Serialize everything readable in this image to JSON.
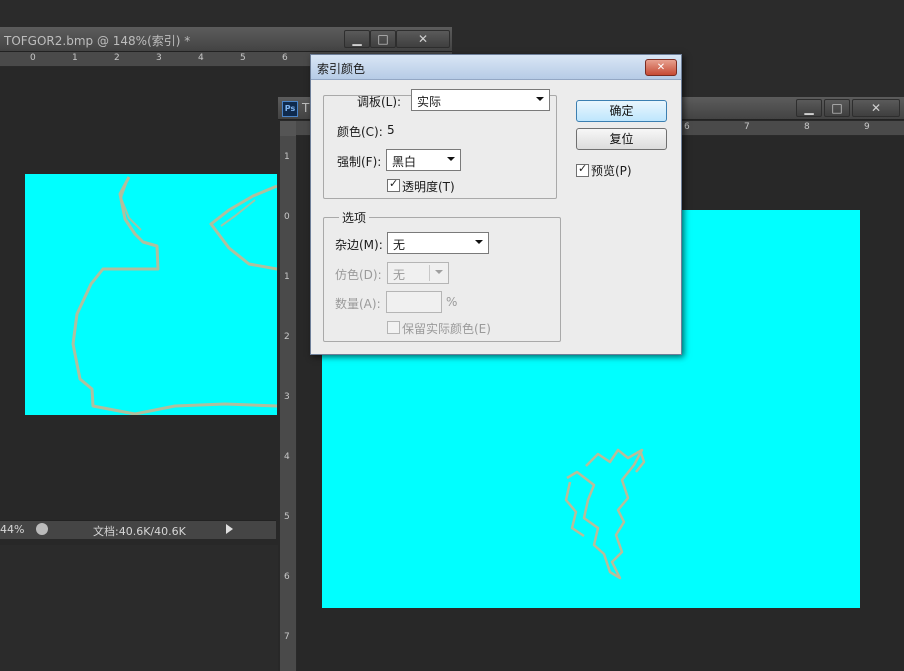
{
  "back_window": {
    "title": "TOFGOR2.bmp @ 148%(索引) *",
    "zoom": "44%",
    "doc_info": "文档:40.6K/40.6K",
    "ruler_h": [
      "0",
      "1",
      "2",
      "3",
      "4",
      "5",
      "6"
    ],
    "ruler_v": [
      "1",
      "0",
      "1",
      "2",
      "3"
    ]
  },
  "front_window": {
    "title": "T",
    "ps_badge": "Ps",
    "ruler_h": [
      "6",
      "7",
      "8",
      "9"
    ],
    "ruler_v": [
      "1",
      "0",
      "1",
      "2",
      "3",
      "4",
      "5",
      "6",
      "7"
    ]
  },
  "window_controls": {
    "minimize": "▁",
    "maximize": "□",
    "close": "✕"
  },
  "dialog": {
    "title": "索引颜色",
    "close": "✕",
    "palette": {
      "label": "调板(L):",
      "value": "实际"
    },
    "colors": {
      "label": "颜色(C):",
      "value": "5"
    },
    "forced": {
      "label": "强制(F):",
      "value": "黑白"
    },
    "transparency": {
      "label": "透明度(T)",
      "checked": true
    },
    "options_group": "选项",
    "matte": {
      "label": "杂边(M):",
      "value": "无"
    },
    "dither": {
      "label": "仿色(D):",
      "value": "无"
    },
    "amount": {
      "label": "数量(A):",
      "unit": "%"
    },
    "preserve": {
      "label": "保留实际颜色(E)"
    },
    "ok": "确定",
    "reset": "复位",
    "preview": {
      "label": "预览(P)",
      "checked": true
    }
  },
  "colors": {
    "canvas": "#00ffff",
    "outline": "#c3b894",
    "dialog_bg": "#ececec"
  }
}
